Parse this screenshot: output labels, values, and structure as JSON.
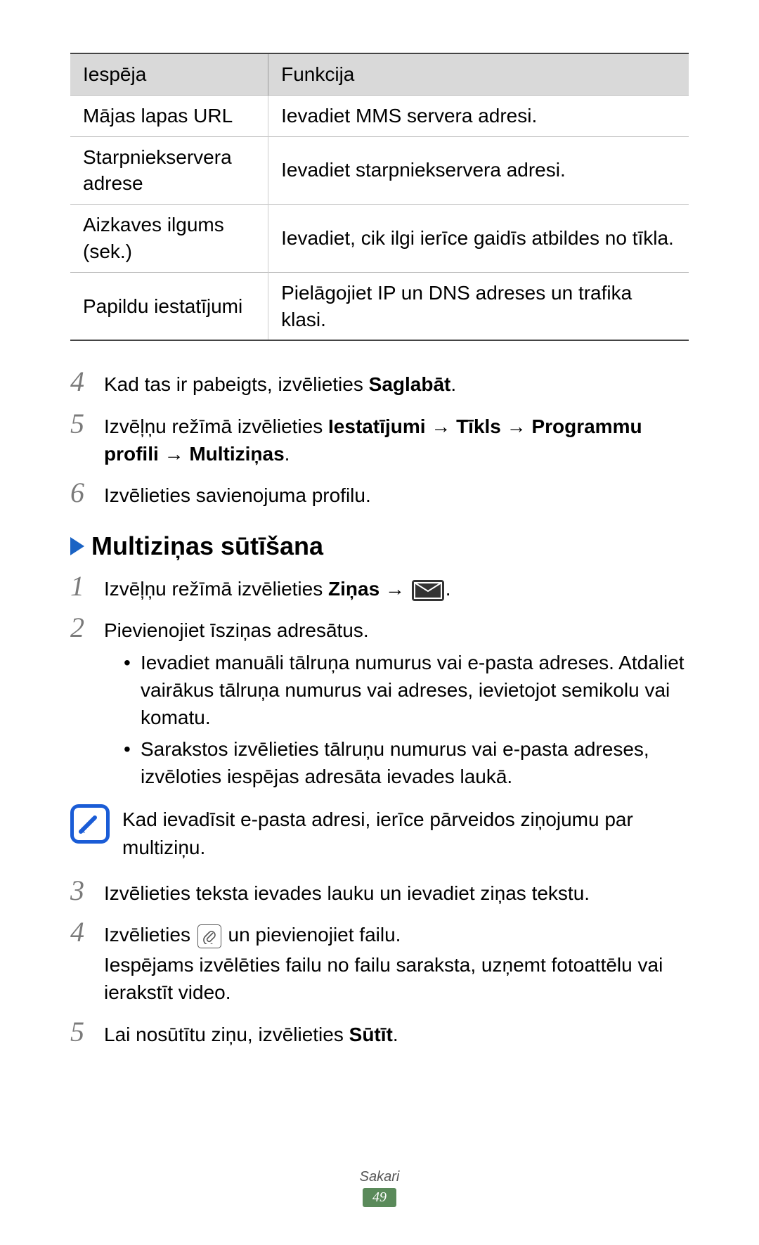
{
  "table": {
    "headers": {
      "col1": "Iespēja",
      "col2": "Funkcija"
    },
    "rows": [
      {
        "col1": "Mājas lapas URL",
        "col2": "Ievadiet MMS servera adresi."
      },
      {
        "col1": "Starpniekservera adrese",
        "col2": "Ievadiet starpniekservera adresi."
      },
      {
        "col1": "Aizkaves ilgums (sek.)",
        "col2": "Ievadiet, cik ilgi ierīce gaidīs atbildes no tīkla."
      },
      {
        "col1": "Papildu iestatījumi",
        "col2": "Pielāgojiet IP un DNS adreses un trafika klasi."
      }
    ]
  },
  "stepsA": {
    "s4": {
      "num": "4",
      "text_pre": "Kad tas ir pabeigts, izvēlieties ",
      "bold": "Saglabāt",
      "text_post": "."
    },
    "s5": {
      "num": "5",
      "pre": "Izvēļņu režīmā izvēlieties ",
      "b1": "Iestatījumi",
      "arrow1": " → ",
      "b2": "Tīkls",
      "arrow2": " → ",
      "b3": "Programmu profili",
      "arrow3": " → ",
      "b4": "Multiziņas",
      "post": "."
    },
    "s6": {
      "num": "6",
      "text": "Izvēlieties savienojuma profilu."
    }
  },
  "heading": "Multiziņas sūtīšana",
  "stepsB": {
    "s1": {
      "num": "1",
      "pre": "Izvēļņu režīmā izvēlieties ",
      "b1": "Ziņas",
      "arrow": " → ",
      "post": "."
    },
    "s2": {
      "num": "2",
      "text": "Pievienojiet īsziņas adresātus.",
      "bullets": [
        "Ievadiet manuāli tālruņa numurus vai e-pasta adreses. Atdaliet vairākus tālruņa numurus vai adreses, ievietojot semikolu vai komatu.",
        "Sarakstos izvēlieties tālruņu numurus vai e-pasta adreses, izvēloties iespējas adresāta ievades laukā."
      ]
    },
    "s3": {
      "num": "3",
      "text": "Izvēlieties teksta ievades lauku un ievadiet ziņas tekstu."
    },
    "s4": {
      "num": "4",
      "pre": "Izvēlieties ",
      "post": " un pievienojiet failu.",
      "extra": "Iespējams izvēlēties failu no failu saraksta, uzņemt fotoattēlu vai ierakstīt video."
    },
    "s5": {
      "num": "5",
      "pre": "Lai nosūtītu ziņu, izvēlieties ",
      "bold": "Sūtīt",
      "post": "."
    }
  },
  "note": "Kad ievadīsit e-pasta adresi, ierīce pārveidos ziņojumu par multiziņu.",
  "footer": {
    "section": "Sakari",
    "page": "49"
  }
}
